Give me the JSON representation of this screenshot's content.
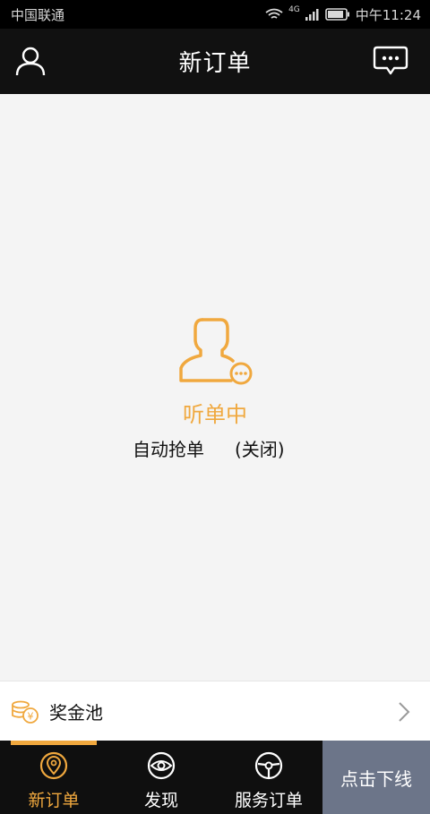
{
  "status_bar": {
    "carrier": "中国联通",
    "network": "4G",
    "time": "中午11:24"
  },
  "header": {
    "title": "新订单",
    "left_icon": "user-icon",
    "right_icon": "chat-bubble-icon"
  },
  "main": {
    "listen_status": "听单中",
    "auto_grab_label": "自动抢单",
    "auto_grab_state": "(关闭)"
  },
  "prize_pool": {
    "label": "奖金池",
    "icon": "coin-stack-icon"
  },
  "tabs": [
    {
      "label": "新订单",
      "icon": "location-pin-icon",
      "active": true
    },
    {
      "label": "发现",
      "icon": "eye-icon",
      "active": false
    },
    {
      "label": "服务订单",
      "icon": "steering-wheel-icon",
      "active": false
    }
  ],
  "offline_button": {
    "label": "点击下线"
  },
  "colors": {
    "accent": "#f0a83e",
    "header_bg": "#111111",
    "offline_bg": "#6c7589",
    "background": "#f4f4f4"
  }
}
